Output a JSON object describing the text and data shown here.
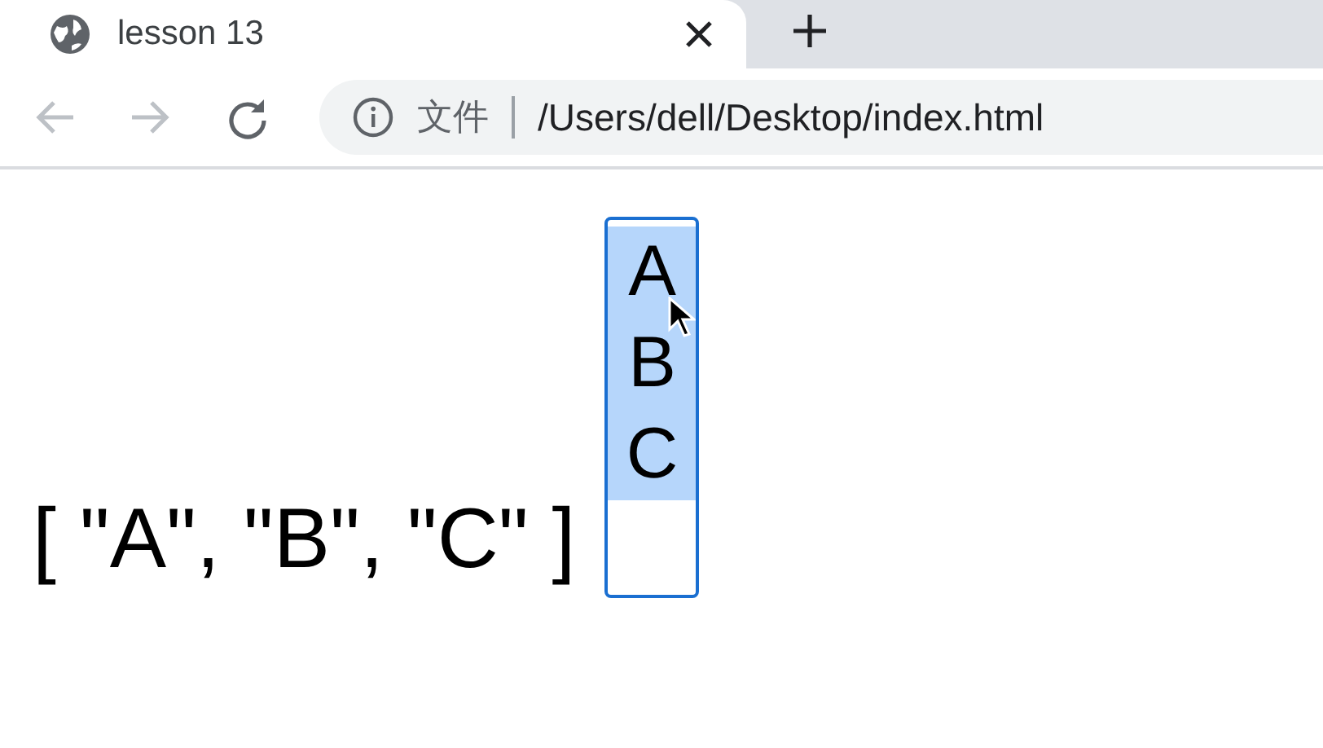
{
  "tab": {
    "title": "lesson 13"
  },
  "address_bar": {
    "security_label": "文件",
    "url": "/Users/dell/Desktop/index.html"
  },
  "output": {
    "text": "[ \"A\", \"B\", \"C\" ]"
  },
  "listbox": {
    "options": [
      {
        "label": "A",
        "selected": true
      },
      {
        "label": "B",
        "selected": true
      },
      {
        "label": "C",
        "selected": true
      }
    ]
  }
}
